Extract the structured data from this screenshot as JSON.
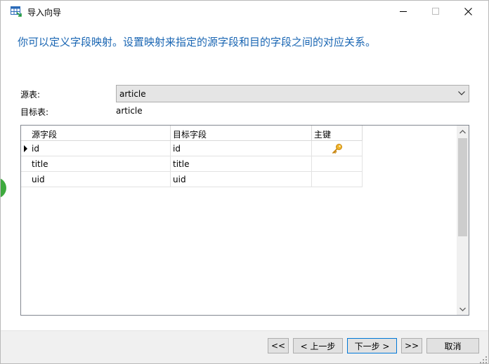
{
  "window": {
    "title": "导入向导",
    "icon": "table-import-icon"
  },
  "heading": "你可以定义字段映射。设置映射来指定的源字段和目的字段之间的对应关系。",
  "source": {
    "label": "源表:",
    "value": "article"
  },
  "target": {
    "label": "目标表:",
    "value": "article"
  },
  "grid": {
    "columns": [
      "源字段",
      "目标字段",
      "主键"
    ],
    "rows": [
      {
        "source": "id",
        "target": "id",
        "primary_key": true,
        "current": true
      },
      {
        "source": "title",
        "target": "title",
        "primary_key": false,
        "current": false
      },
      {
        "source": "uid",
        "target": "uid",
        "primary_key": false,
        "current": false
      }
    ]
  },
  "buttons": {
    "first": "<<",
    "prev": "< 上一步",
    "next": "下一步 >",
    "last": ">>",
    "cancel": "取消"
  },
  "colors": {
    "heading": "#1a66b3",
    "key": "#e5a31a",
    "accent": "#0078d7"
  }
}
